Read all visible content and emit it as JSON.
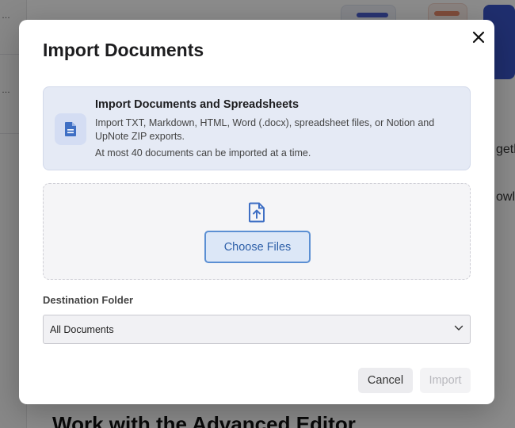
{
  "modal": {
    "title": "Import Documents",
    "close_icon": "close-icon"
  },
  "info": {
    "icon": "document-icon",
    "title": "Import Documents and Spreadsheets",
    "description": "Import TXT, Markdown, HTML, Word (.docx), spreadsheet files, or Notion and UpNote ZIP exports.",
    "limit": "At most 40 documents can be imported at a time."
  },
  "dropzone": {
    "icon": "file-upload-icon",
    "button_label": "Choose Files"
  },
  "destination": {
    "label": "Destination Folder",
    "selected": "All Documents",
    "icon": "chevron-down-icon"
  },
  "footer": {
    "cancel_label": "Cancel",
    "import_label": "Import"
  },
  "background": {
    "heading": "Work with the Advanced Editor",
    "partial_text_1": "geth",
    "partial_text_2": "owle"
  },
  "colors": {
    "accent": "#2d5fa8",
    "info_bg": "#e5eaf5",
    "button_border": "#5b8fd3"
  }
}
